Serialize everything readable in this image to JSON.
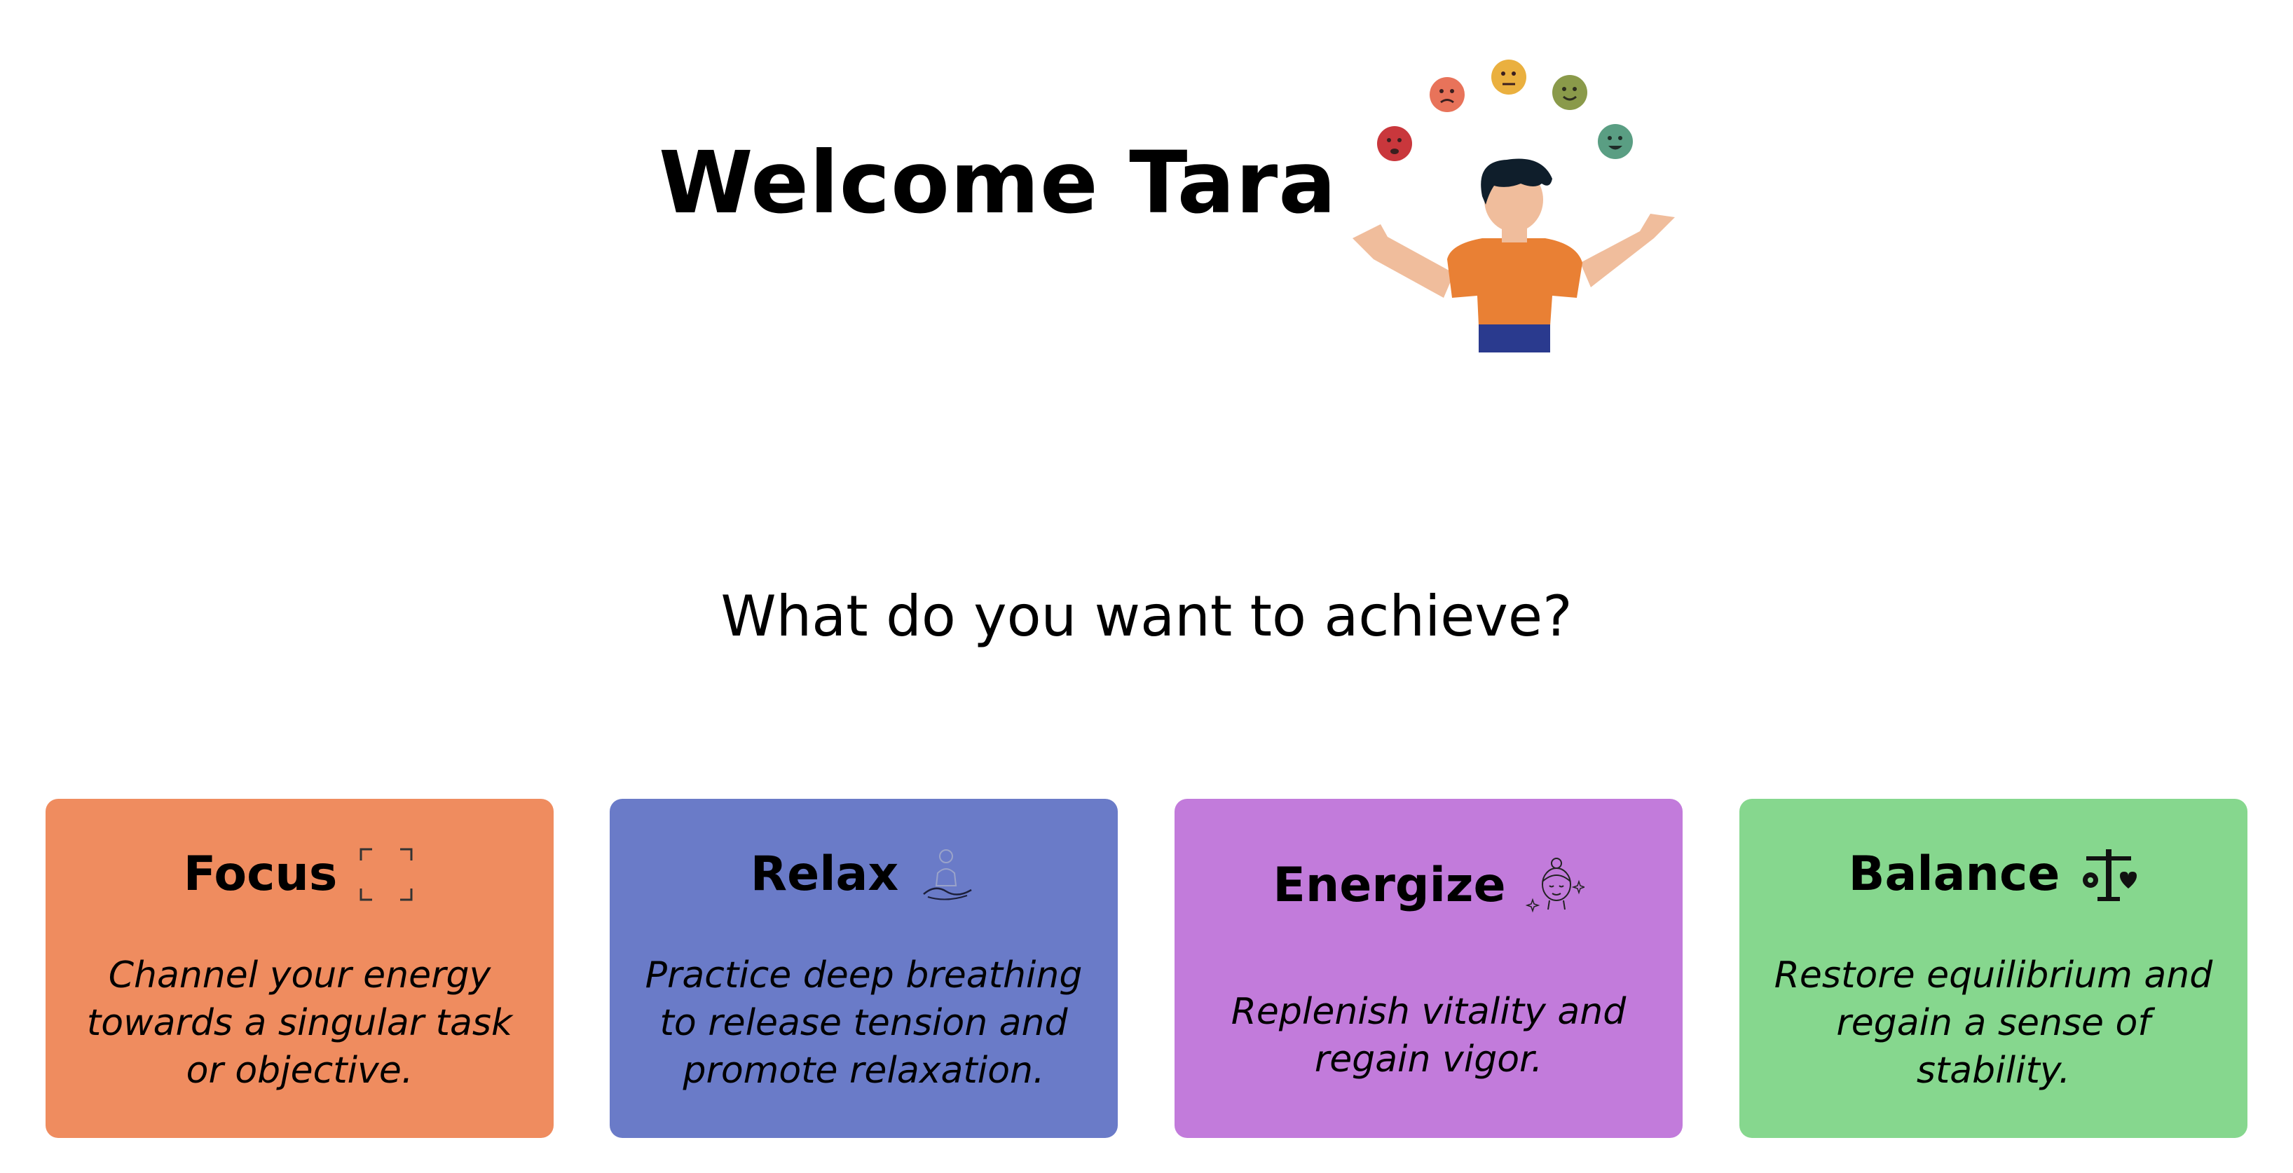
{
  "header": {
    "title": "Welcome Tara"
  },
  "hero": {
    "illustration": "person-juggling-mood-faces",
    "faces": [
      "sad-face-icon",
      "unhappy-face-icon",
      "neutral-face-icon",
      "content-face-icon",
      "happy-face-icon"
    ],
    "face_colors": [
      "#c9373c",
      "#e8735a",
      "#eab03f",
      "#8a9a4a",
      "#5a9e83"
    ]
  },
  "prompt": {
    "question": "What do you want to achieve?"
  },
  "cards": [
    {
      "title": "Focus",
      "icon": "focus-frame-icon",
      "description": "Channel your energy towards a singular task or objective.",
      "color": "#ef8c5f"
    },
    {
      "title": "Relax",
      "icon": "meditation-icon",
      "description": "Practice deep breathing to release tension and promote relaxation.",
      "color": "#6a7bc8"
    },
    {
      "title": "Energize",
      "icon": "refreshed-face-icon",
      "description": "Replenish vitality and regain vigor.",
      "color": "#c27bdb"
    },
    {
      "title": "Balance",
      "icon": "balance-scale-icon",
      "description": "Restore equilibrium and regain a sense of stability.",
      "color": "#86d78e"
    }
  ]
}
